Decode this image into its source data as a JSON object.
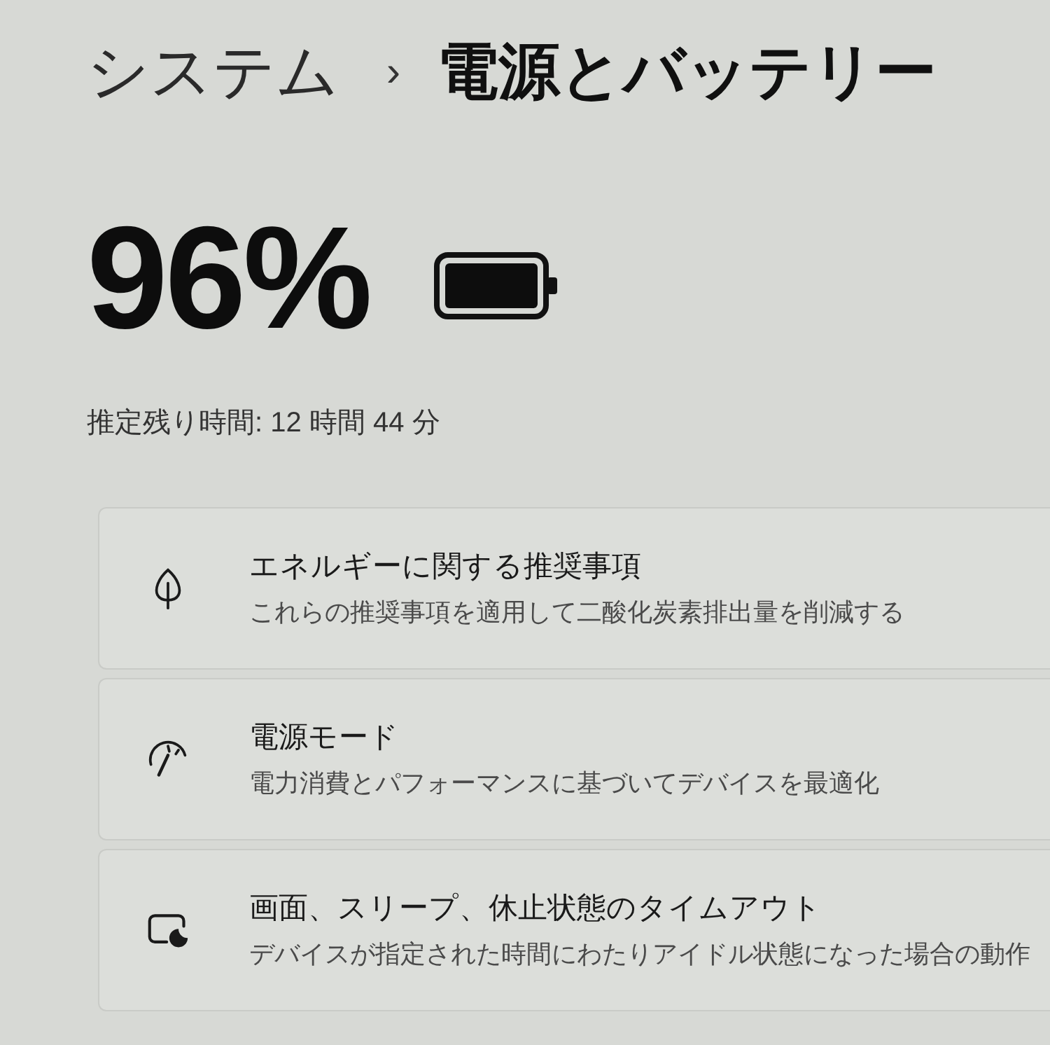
{
  "breadcrumb": {
    "parent": "システム",
    "separator": "›",
    "current": "電源とバッテリー"
  },
  "battery": {
    "percent": "96%",
    "estimate": "推定残り時間: 12 時間 44 分"
  },
  "settings": [
    {
      "title": "エネルギーに関する推奨事項",
      "description": "これらの推奨事項を適用して二酸化炭素排出量を削減する"
    },
    {
      "title": "電源モード",
      "description": "電力消費とパフォーマンスに基づいてデバイスを最適化"
    },
    {
      "title": "画面、スリープ、休止状態のタイムアウト",
      "description": "デバイスが指定された時間にわたりアイドル状態になった場合の動作"
    }
  ]
}
